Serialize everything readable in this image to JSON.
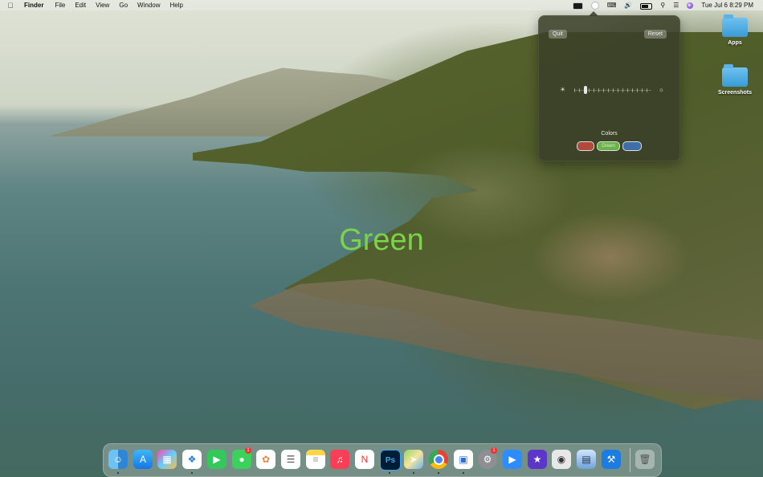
{
  "menubar": {
    "app_name": "Finder",
    "menus": [
      "File",
      "Edit",
      "View",
      "Go",
      "Window",
      "Help"
    ],
    "status_icons": [
      "extension-icon",
      "circle-icon",
      "keyboard-icon",
      "volume-icon",
      "battery-icon",
      "search-icon",
      "control-center-icon",
      "siri-icon"
    ],
    "clock": "Tue Jul 6  8:29 PM"
  },
  "panel": {
    "quit_label": "Quit",
    "reset_label": "Reset",
    "brightness_level": 0.1,
    "colors_label": "Colors",
    "color_options": [
      "Red",
      "Green",
      "Blue"
    ],
    "selected_color": "Green",
    "colors": {
      "red": "#b04a3a",
      "green": "#6bb24a",
      "blue": "#3e6fa8"
    }
  },
  "desktop": {
    "icons": [
      {
        "label": "Apps",
        "icon": "folder-icon"
      },
      {
        "label": "Screenshots",
        "icon": "folder-icon"
      }
    ],
    "center_text": "Green",
    "center_text_color": "#7ad34a"
  },
  "dock": {
    "apps": [
      {
        "name": "Finder",
        "icon": "finder-icon",
        "running": true
      },
      {
        "name": "App Store",
        "icon": "app-store-icon",
        "running": false
      },
      {
        "name": "Launchpad",
        "icon": "launchpad-icon",
        "running": false
      },
      {
        "name": "Safari",
        "icon": "safari-icon",
        "running": true
      },
      {
        "name": "FaceTime",
        "icon": "facetime-icon",
        "running": false
      },
      {
        "name": "Messages",
        "icon": "messages-icon",
        "running": false,
        "badge": "1"
      },
      {
        "name": "Photos",
        "icon": "photos-icon",
        "running": false
      },
      {
        "name": "Reminders",
        "icon": "reminders-icon",
        "running": false
      },
      {
        "name": "Notes",
        "icon": "notes-icon",
        "running": false
      },
      {
        "name": "Music",
        "icon": "music-icon",
        "running": false
      },
      {
        "name": "News",
        "icon": "news-icon",
        "running": false
      },
      {
        "name": "Photoshop",
        "icon": "photoshop-icon",
        "running": true,
        "label": "Ps"
      },
      {
        "name": "Maps",
        "icon": "maps-icon",
        "running": true
      },
      {
        "name": "Chrome",
        "icon": "chrome-icon",
        "running": true
      },
      {
        "name": "Keynote",
        "icon": "keynote-icon",
        "running": true
      },
      {
        "name": "System Preferences",
        "icon": "system-preferences-icon",
        "running": false,
        "badge": "1"
      },
      {
        "name": "Zoom",
        "icon": "zoom-icon",
        "running": false
      },
      {
        "name": "iMovie",
        "icon": "imovie-icon",
        "running": false
      },
      {
        "name": "Screenshot",
        "icon": "screenshot-icon",
        "running": false
      },
      {
        "name": "Preview",
        "icon": "preview-icon",
        "running": false
      },
      {
        "name": "Xcode",
        "icon": "xcode-icon",
        "running": false
      },
      {
        "name": "Trash",
        "icon": "trash-icon",
        "running": false
      }
    ]
  }
}
